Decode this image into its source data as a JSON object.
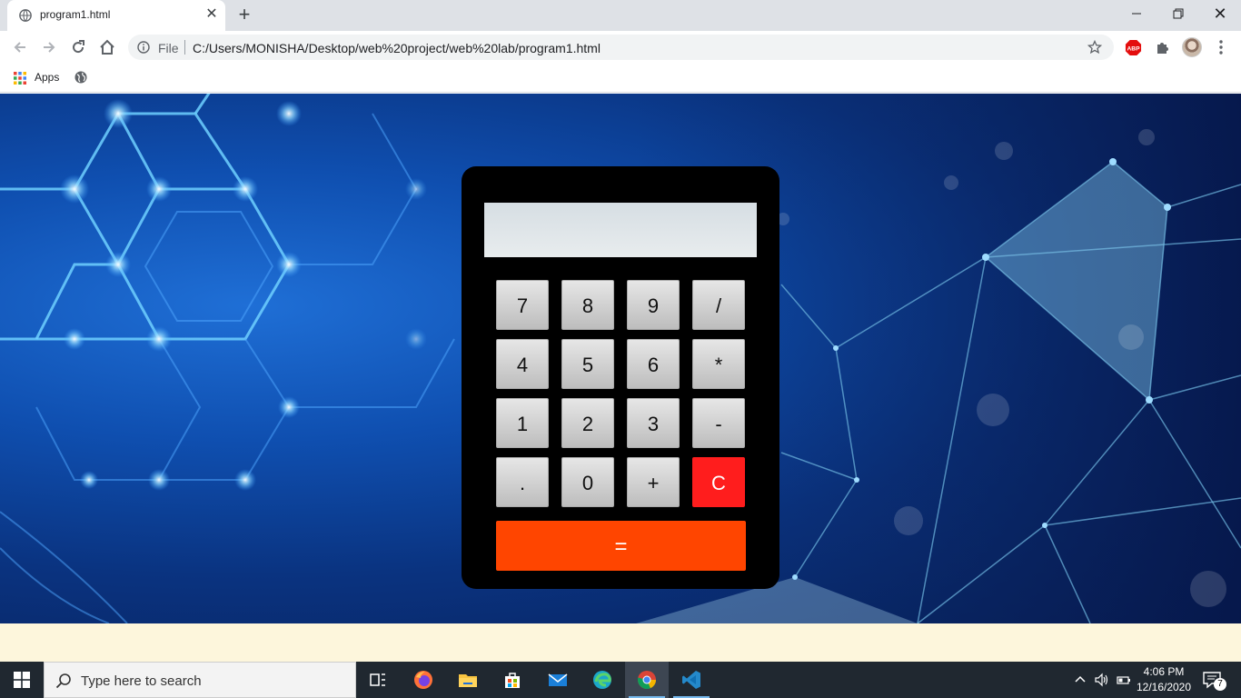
{
  "browser": {
    "tab": {
      "title": "program1.html",
      "favicon": "globe-icon"
    },
    "address": {
      "scheme_label": "File",
      "url": "C:/Users/MONISHA/Desktop/web%20project/web%20lab/program1.html"
    },
    "bookmarks": {
      "apps_label": "Apps"
    },
    "extensions": {
      "abp_label": "ABP"
    }
  },
  "calculator": {
    "display_value": "",
    "keys": [
      [
        "7",
        "8",
        "9",
        "/"
      ],
      [
        "4",
        "5",
        "6",
        "*"
      ],
      [
        "1",
        "2",
        "3",
        "-"
      ],
      [
        ".",
        "0",
        "+",
        "C"
      ]
    ],
    "equals_label": "=",
    "colors": {
      "body": "#000000",
      "clear": "#ff1d1d",
      "equals": "#ff4500",
      "key": "#d0d0d0"
    }
  },
  "taskbar": {
    "search_placeholder": "Type here to search",
    "clock": {
      "time": "4:06 PM",
      "date": "12/16/2020"
    },
    "notification_count": "7",
    "apps": [
      "task-view-icon",
      "firefox-icon",
      "file-explorer-icon",
      "store-icon",
      "mail-icon",
      "edge-icon",
      "chrome-icon",
      "vscode-icon"
    ]
  }
}
